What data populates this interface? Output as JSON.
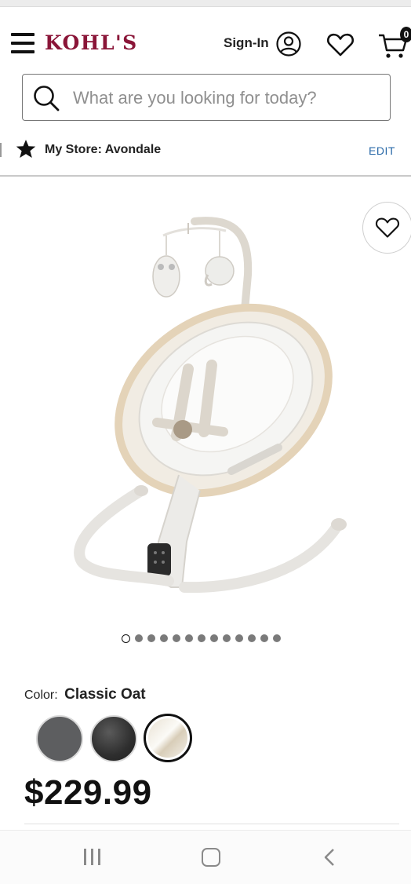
{
  "header": {
    "logo_text": "KOHL'S",
    "logo_color": "#8a1538",
    "signin_label": "Sign-In",
    "cart_count": "0"
  },
  "search": {
    "placeholder": "What are you looking for today?"
  },
  "store": {
    "label": "My Store: Avondale",
    "edit_label": "EDIT",
    "edit_color": "#2a6aa8"
  },
  "gallery": {
    "image_count": 13,
    "active_index": 0
  },
  "product": {
    "color_label": "Color:",
    "color_value": "Classic Oat",
    "swatches": [
      {
        "name": "gray",
        "color": "#5d5e60",
        "selected": false
      },
      {
        "name": "black",
        "color": "#2e2e2e",
        "selected": false
      },
      {
        "name": "classic-oat",
        "color": "#e9e2d4",
        "selected": true
      }
    ],
    "price": "$229.99"
  },
  "icons": {
    "menu": "hamburger-icon",
    "account": "user-circle-icon",
    "wishlist": "heart-icon",
    "cart": "cart-icon",
    "search": "search-icon",
    "store": "star-icon",
    "favorite": "heart-outline-icon"
  }
}
